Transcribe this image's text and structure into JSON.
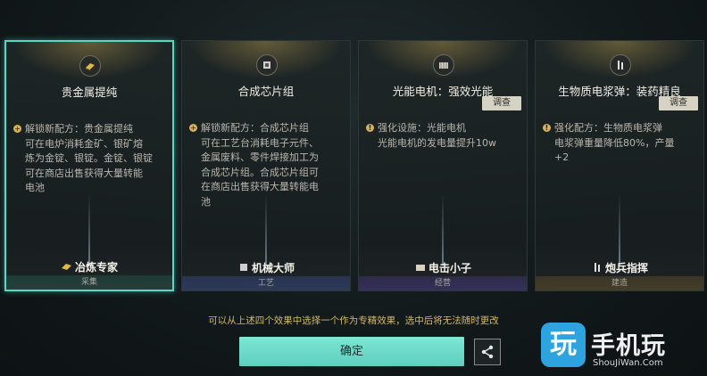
{
  "cards": [
    {
      "title": "贵金属提纯",
      "description_lines": [
        "解锁新配方：贵金属提纯",
        "可在电炉消耗金矿、银矿熔",
        "炼为金锭、银锭。金锭、银锭",
        "可在商店出售获得大量转能",
        "电池"
      ],
      "badge": "冶炼专家",
      "category": "采集",
      "icon": "gold-bar-icon",
      "selected": true
    },
    {
      "title": "合成芯片组",
      "description_lines": [
        "解锁新配方：合成芯片组",
        "可在工艺台消耗电子元件、",
        "金属废料、零件焊接加工为",
        "合成芯片组。合成芯片组可",
        "在商店出售获得大量转能电",
        "池"
      ],
      "badge": "机械大师",
      "category": "工艺",
      "icon": "chip-icon"
    },
    {
      "title": "光能电机：强效光能",
      "inspect": "调查",
      "description_lines": [
        "强化设施：光能电机",
        "光能电机的发电量提升10w"
      ],
      "badge": "电击小子",
      "category": "经营",
      "icon": "solar-motor-icon"
    },
    {
      "title": "生物质电浆弹：装药精良",
      "inspect": "调查",
      "description_lines": [
        "强化配方：生物质电浆弹",
        "电浆弹重量降低80%，产量",
        "+2"
      ],
      "badge": "炮兵指挥",
      "category": "建造",
      "icon": "shell-icon"
    }
  ],
  "notice": "可以从上述四个效果中选择一个作为专精效果，选中后将无法随时更改",
  "confirm_label": "确定",
  "watermark": {
    "logo_char": "玩",
    "name": "手机玩",
    "url": "ShouJiWan.Com"
  },
  "colors": {
    "accent": "#59d6c4",
    "gold": "#d6b25a",
    "confirm_bg": "#6ddac9"
  }
}
